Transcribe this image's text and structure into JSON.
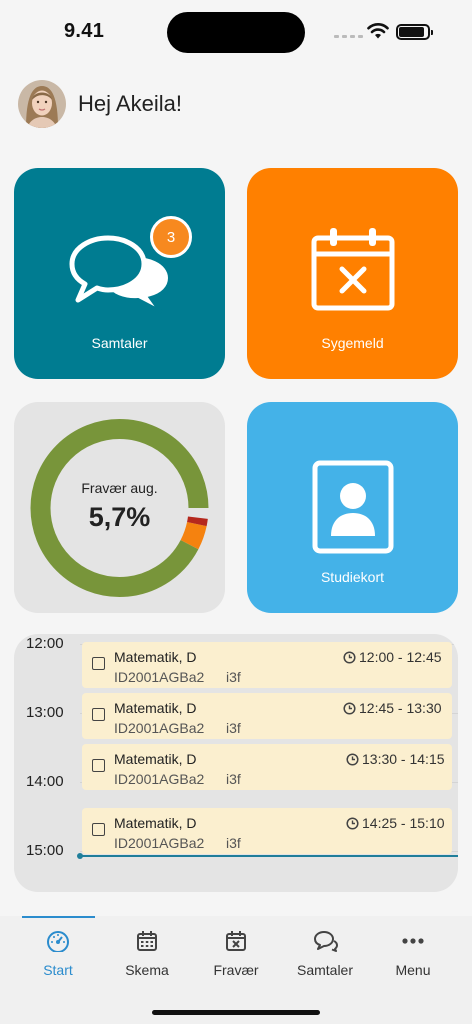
{
  "status_bar": {
    "time": "9.41"
  },
  "greeting": {
    "text": "Hej Akeila!"
  },
  "tiles": {
    "samtaler": {
      "label": "Samtaler",
      "badge": "3"
    },
    "sygemeld": {
      "label": "Sygemeld"
    },
    "fravaer": {
      "label": "Fravær aug.",
      "value": "5,7%",
      "segments": {
        "present": 0.943,
        "orange": 0.044,
        "red": 0.013
      }
    },
    "studiekort": {
      "label": "Studiekort"
    }
  },
  "schedule": {
    "hours": [
      "12:00",
      "13:00",
      "14:00",
      "15:00"
    ],
    "events": [
      {
        "subject": "Matematik, D",
        "code": "ID2001AGBa2",
        "room": "i3f",
        "time": "12:00 - 12:45"
      },
      {
        "subject": "Matematik, D",
        "code": "ID2001AGBa2",
        "room": "i3f",
        "time": "12:45 - 13:30"
      },
      {
        "subject": "Matematik, D",
        "code": "ID2001AGBa2",
        "room": "i3f",
        "time": "13:30 - 14:15"
      },
      {
        "subject": "Matematik, D",
        "code": "ID2001AGBa2",
        "room": "i3f",
        "time": "14:25 - 15:10"
      }
    ]
  },
  "tab_bar": {
    "tabs": [
      {
        "label": "Start",
        "icon": "dashboard-icon",
        "active": true
      },
      {
        "label": "Skema",
        "icon": "calendar-icon",
        "active": false
      },
      {
        "label": "Fravær",
        "icon": "calendar-x-icon",
        "active": false
      },
      {
        "label": "Samtaler",
        "icon": "chat-icon",
        "active": false
      },
      {
        "label": "Menu",
        "icon": "more-dots-icon",
        "active": false
      }
    ]
  },
  "colors": {
    "samtaler": "#007c91",
    "sygemeld": "#ff8000",
    "studiekort": "#44b2e8",
    "donut_present": "#78953a",
    "donut_orange": "#f5820f",
    "donut_red": "#b5281d",
    "accent": "#2b8ccd",
    "event_bg": "#fbefcf"
  }
}
